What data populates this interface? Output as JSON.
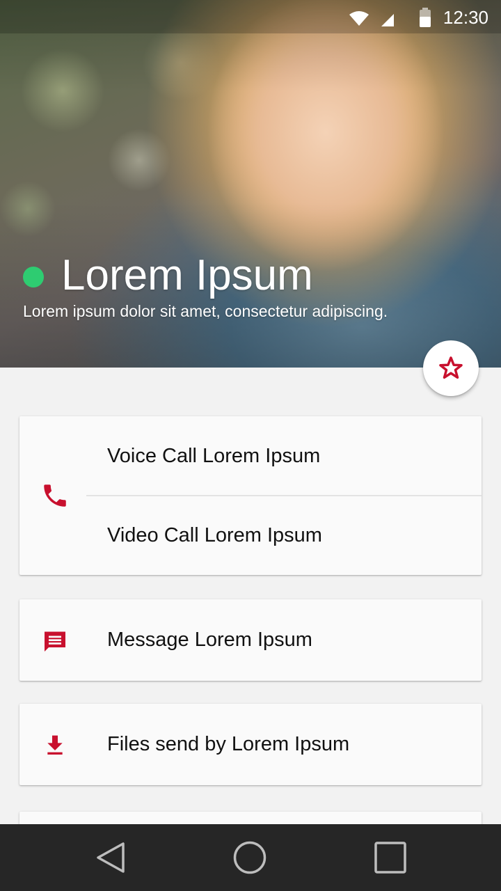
{
  "status_bar": {
    "time": "12:30",
    "icons": [
      "wifi-icon",
      "signal-icon",
      "battery-icon"
    ]
  },
  "contact": {
    "name": "Lorem Ipsum",
    "subtitle": "Lorem ipsum dolor sit amet, consectetur adipiscing.",
    "presence": "online",
    "presence_color": "#2ecc71"
  },
  "fab": {
    "icon": "star-outline-icon"
  },
  "actions": {
    "calls": {
      "icon": "phone-icon",
      "voice_label": "Voice Call Lorem Ipsum",
      "video_label": "Video Call Lorem Ipsum"
    },
    "message": {
      "icon": "message-icon",
      "label": "Message Lorem Ipsum"
    },
    "files": {
      "icon": "download-icon",
      "label": "Files send by Lorem Ipsum"
    }
  },
  "nav_bar": {
    "buttons": [
      "back-icon",
      "home-icon",
      "recents-icon"
    ]
  },
  "colors": {
    "accent": "#c8102e",
    "background": "#f2f2f2",
    "card": "#fafafa",
    "navbar": "#262626"
  }
}
